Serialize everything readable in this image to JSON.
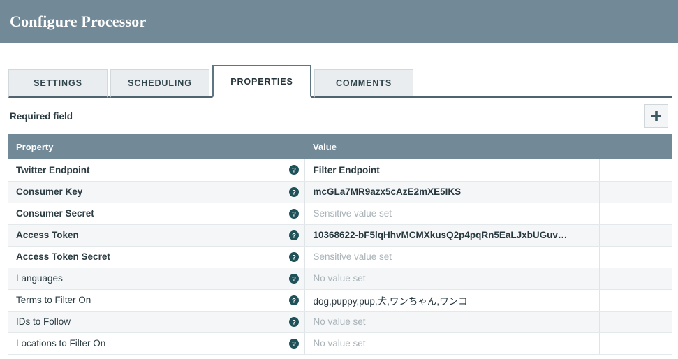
{
  "window": {
    "title": "Configure Processor"
  },
  "tabs": [
    {
      "label": "SETTINGS",
      "active": false
    },
    {
      "label": "SCHEDULING",
      "active": false
    },
    {
      "label": "PROPERTIES",
      "active": true
    },
    {
      "label": "COMMENTS",
      "active": false
    }
  ],
  "toolbar": {
    "required_field_label": "Required field",
    "add_button_icon": "plus-icon"
  },
  "table": {
    "columns": [
      "Property",
      "Value",
      ""
    ],
    "help_icon": "help-circle-icon",
    "rows": [
      {
        "property": "Twitter Endpoint",
        "required": true,
        "value": "Filter Endpoint",
        "value_state": "set"
      },
      {
        "property": "Consumer Key",
        "required": true,
        "value": "mcGLa7MR9azx5cAzE2mXE5IKS",
        "value_state": "set"
      },
      {
        "property": "Consumer Secret",
        "required": true,
        "value": "Sensitive value set",
        "value_state": "muted"
      },
      {
        "property": "Access Token",
        "required": true,
        "value": "10368622-bF5lqHhvMCMXkusQ2p4pqRn5EaLJxbUGuv…",
        "value_state": "set"
      },
      {
        "property": "Access Token Secret",
        "required": true,
        "value": "Sensitive value set",
        "value_state": "muted"
      },
      {
        "property": "Languages",
        "required": false,
        "value": "No value set",
        "value_state": "muted"
      },
      {
        "property": "Terms to Filter On",
        "required": false,
        "value": "dog,puppy,pup,犬,ワンちゃん,ワンコ",
        "value_state": "plain"
      },
      {
        "property": "IDs to Follow",
        "required": false,
        "value": "No value set",
        "value_state": "muted"
      },
      {
        "property": "Locations to Filter On",
        "required": false,
        "value": "No value set",
        "value_state": "muted"
      }
    ]
  },
  "colors": {
    "header_bar": "#728a98",
    "table_header": "#728a98",
    "accent_icon": "#1f5159",
    "tab_active_border": "#5c7683",
    "muted_text": "#a9b3b8"
  }
}
